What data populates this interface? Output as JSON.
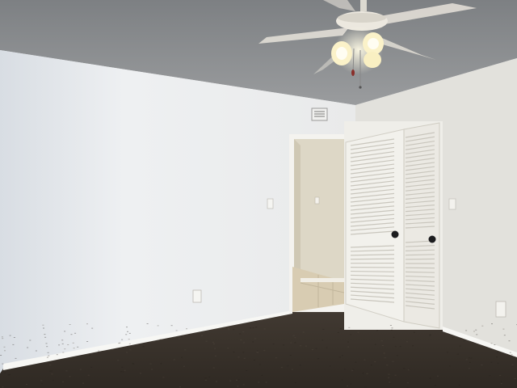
{
  "scene": {
    "kind": "photo",
    "subject": "empty-bedroom",
    "colors": {
      "ceiling": "#8d9093",
      "ceiling_shadow": "#6f7275",
      "left_wall": "#eef0f2",
      "left_wall_shade": "#d9dde2",
      "right_wall": "#e2e1dc",
      "back_wall": "#e7e6e1",
      "carpet": "#3c352e",
      "carpet_dark": "#2c2620",
      "baseboard": "#f7f7f4",
      "door": "#f2f1ec",
      "door_shade": "#dcdad2",
      "louver_line": "#c9c6bd",
      "knob": "#1c1c1e",
      "hall_wall": "#ddd7c6",
      "hall_floor": "#d8ccb2",
      "fan_blade": "#e7e3da",
      "fan_light": "#fbf2c9"
    }
  }
}
